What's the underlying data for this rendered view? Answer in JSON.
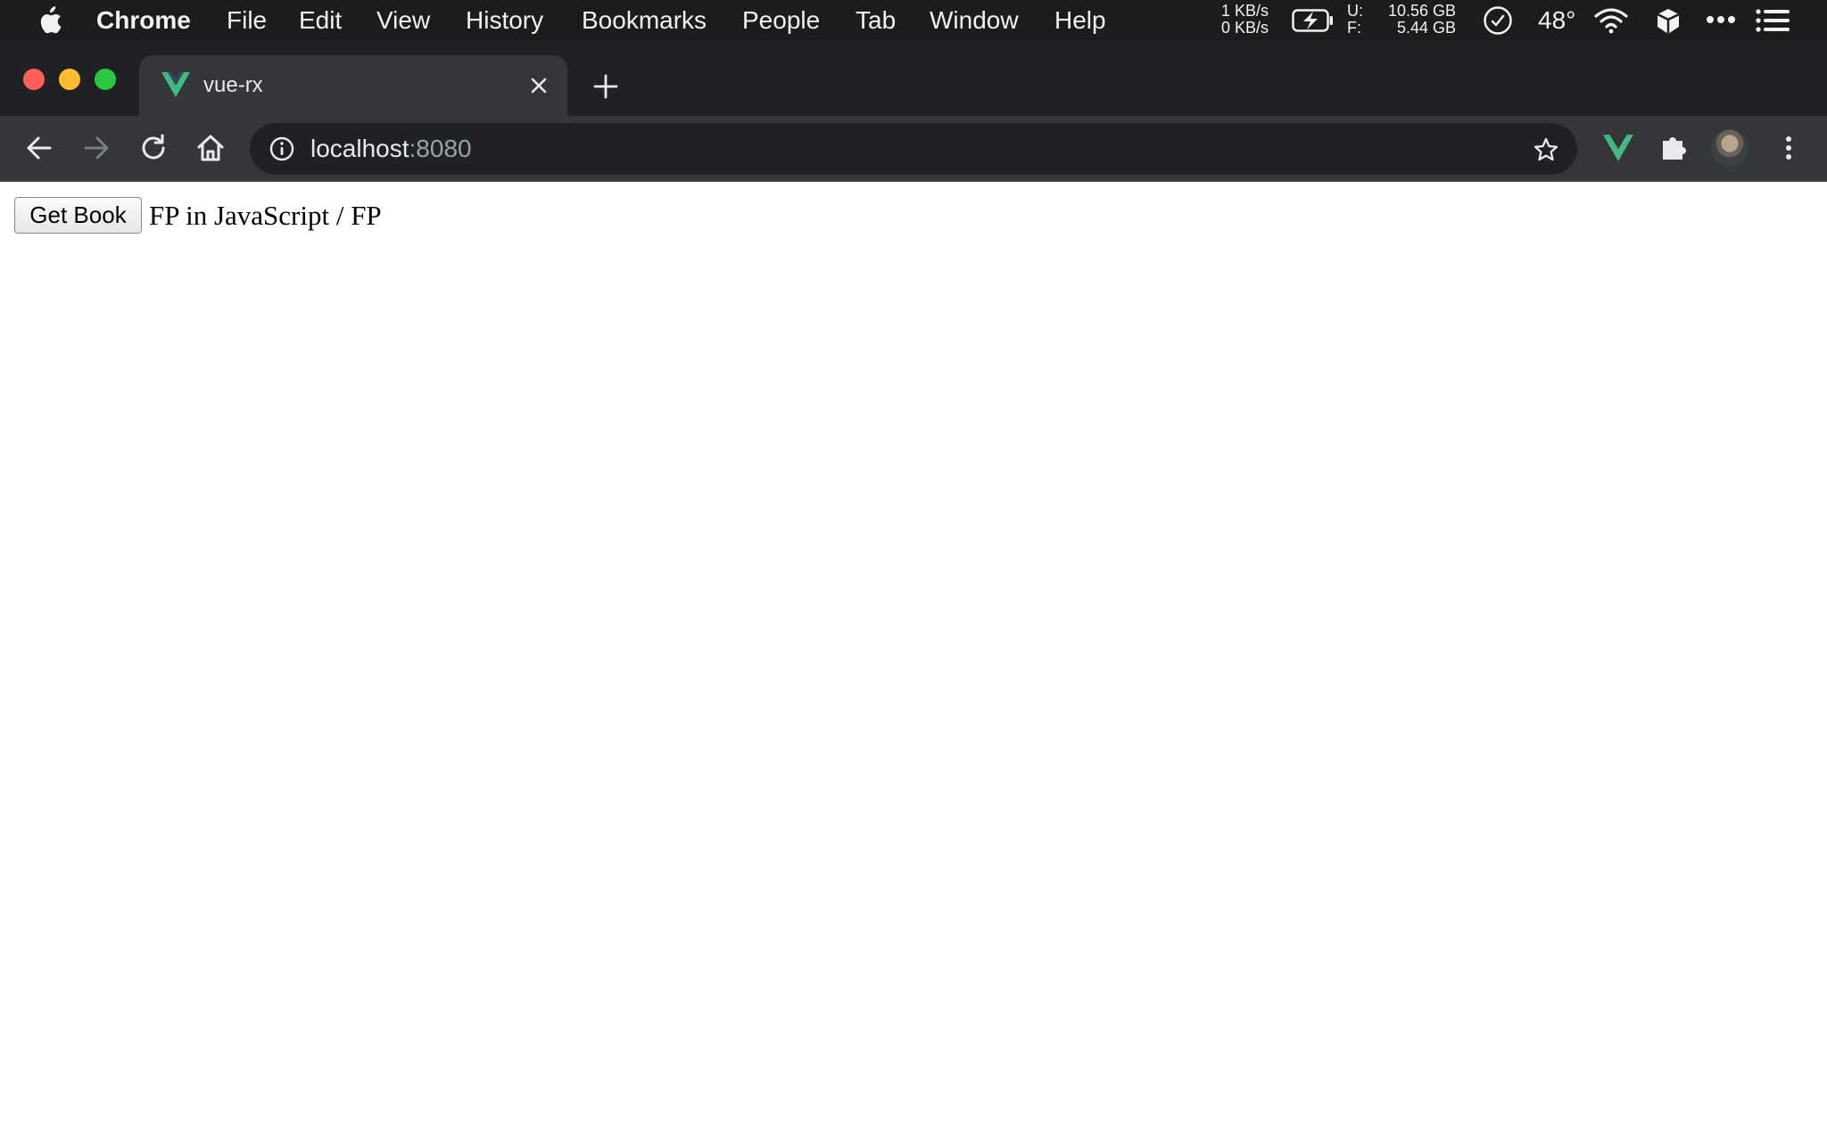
{
  "menubar": {
    "app_name": "Chrome",
    "items": [
      "File",
      "Edit",
      "View",
      "History",
      "Bookmarks",
      "People",
      "Tab",
      "Window",
      "Help"
    ],
    "status": {
      "net_up": "1 KB/s",
      "net_down": "0 KB/s",
      "disk_used_label": "U:",
      "disk_free_label": "F:",
      "disk_used": "10.56 GB",
      "disk_free": "5.44 GB",
      "temperature": "48°",
      "icons": [
        "battery-charging-icon",
        "clock-icon",
        "wifi-icon",
        "cube-icon",
        "more-icon",
        "list-icon"
      ]
    }
  },
  "browser": {
    "tab": {
      "title": "vue-rx",
      "favicon": "vue-logo-icon"
    },
    "address": {
      "host": "localhost",
      "port": ":8080"
    },
    "colors": {
      "vue_green": "#42b883",
      "close": "#ff5f57",
      "minimize": "#febc2e",
      "zoom": "#28c840"
    }
  },
  "page": {
    "button_label": "Get Book",
    "book_text": "FP in JavaScript / FP"
  }
}
